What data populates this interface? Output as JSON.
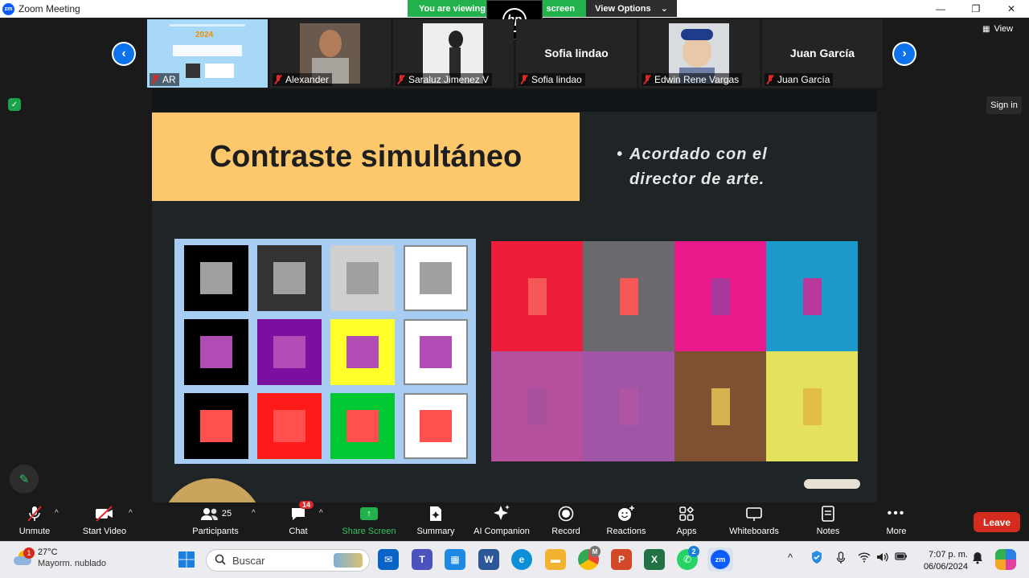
{
  "window": {
    "app_logo": "zm",
    "title": "Zoom Meeting",
    "controls": [
      "—",
      "❐",
      "✕"
    ]
  },
  "share_banner": {
    "text_left": "You are viewing",
    "text_right": "screen",
    "options_label": "View Options",
    "presenter_logo": "hp"
  },
  "gallery": {
    "view_label": "View",
    "tiles": [
      {
        "name": "AR",
        "type": "share-thumb"
      },
      {
        "name": "Alexander",
        "type": "photo"
      },
      {
        "name": "Saraluz Jimenez V",
        "type": "photo"
      },
      {
        "name": "Sofia lindao",
        "type": "text",
        "display_name": "Sofia lindao"
      },
      {
        "name": "Edwin Rene Vargas",
        "type": "photo"
      },
      {
        "name": "Juan García",
        "type": "text",
        "display_name": "Juan García"
      }
    ],
    "thumb_text": "2024"
  },
  "side": {
    "sign_in": "Sign in"
  },
  "slide": {
    "title": "Contraste simultáneo",
    "bullet_line1": "Acordado con el",
    "bullet_line2": "director de arte.",
    "grid1": [
      [
        {
          "bg": "#000000",
          "sq": "#a0a0a0"
        },
        {
          "bg": "#333333",
          "sq": "#a0a0a0"
        },
        {
          "bg": "#cfcfcf",
          "sq": "#a0a0a0"
        },
        {
          "bg": "#ffffff",
          "sq": "#a0a0a0"
        }
      ],
      [
        {
          "bg": "#000000",
          "sq": "#b04cb4"
        },
        {
          "bg": "#7a0fa0",
          "sq": "#b04cb4"
        },
        {
          "bg": "#ffff2a",
          "sq": "#b04cb4"
        },
        {
          "bg": "#ffffff",
          "sq": "#b04cb4"
        }
      ],
      [
        {
          "bg": "#000000",
          "sq": "#ff4f4f"
        },
        {
          "bg": "#ff1a1a",
          "sq": "#ff4f4f"
        },
        {
          "bg": "#00c832",
          "sq": "#ff4f4f"
        },
        {
          "bg": "#ffffff",
          "sq": "#ff4f4f"
        }
      ]
    ],
    "grid2": [
      [
        {
          "bg": "#ee1d3a",
          "bar": "#f55656"
        },
        {
          "bg": "#6a6a6e",
          "bar": "#f55656"
        },
        {
          "bg": "#ea1a8c",
          "bar": "#a8389c"
        },
        {
          "bg": "#1c9acb",
          "bar": "#b8389c"
        }
      ],
      [
        {
          "bg": "#b4509e",
          "bar": "#a8509c"
        },
        {
          "bg": "#a155a6",
          "bar": "#b156a4"
        },
        {
          "bg": "#7d5131",
          "bar": "#d8b24e"
        },
        {
          "bg": "#e4e15c",
          "bar": "#e2be46"
        }
      ]
    ]
  },
  "toolbar": {
    "unmute": "Unmute",
    "start_video": "Start Video",
    "participants": "Participants",
    "participants_count": "25",
    "chat": "Chat",
    "chat_badge": "14",
    "share_screen": "Share Screen",
    "summary": "Summary",
    "ai_companion": "AI Companion",
    "record": "Record",
    "reactions": "Reactions",
    "apps": "Apps",
    "whiteboards": "Whiteboards",
    "notes": "Notes",
    "more": "More",
    "leave": "Leave",
    "colors": {
      "share_green": "#22b14c",
      "leave_red": "#d52b1e",
      "badge_red": "#e02828"
    }
  },
  "taskbar": {
    "weather_temp": "27°C",
    "weather_desc": "Mayorm. nublado",
    "weather_badge": "1",
    "search_placeholder": "Buscar",
    "whatsapp_badge": "2",
    "chrome_badge": "M",
    "time": "7:07 p. m.",
    "date": "06/06/2024"
  }
}
